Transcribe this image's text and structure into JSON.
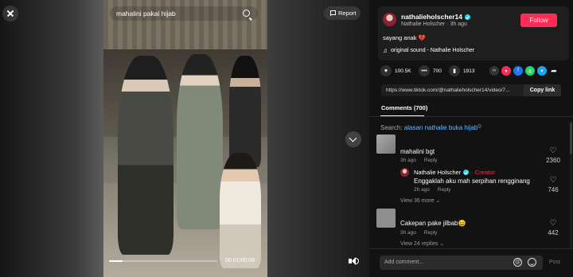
{
  "player": {
    "search_query": "mahalini pakai hijab",
    "report_label": "Report",
    "time": "00:01/00:08",
    "progress": 0.125
  },
  "post": {
    "username": "nathalieholscher14",
    "display_line": "Nathalie Holscher · 3h ago",
    "follow_label": "Follow",
    "caption": "sayang anak",
    "caption_emoji": "💔",
    "sound": "original sound - Nathalie Holscher"
  },
  "actions": {
    "likes": "100.5K",
    "comments": "700",
    "saves": "1913"
  },
  "share": {
    "link": "https://www.tiktok.com/@nathalieholscher14/video/7...",
    "copy_label": "Copy link"
  },
  "comments_tab": "Comments (700)",
  "search_hint": {
    "prefix": "Search: ",
    "term": "alasan nathalie buka hijab",
    "suffix": "Q"
  },
  "comments": [
    {
      "text": "mahalini bgt",
      "time": "3h ago",
      "reply_label": "Reply",
      "likes": "2360",
      "reply": {
        "name": "Nathalie Holscher",
        "creator_label": "· Creator",
        "text": "Enggaklah aku mah serpihan rengginang",
        "time": "2h ago",
        "reply_label": "Reply",
        "likes": "746"
      },
      "view_more": "View 36 more ⌄"
    },
    {
      "text": "Cakepan pake jilbab😄",
      "time": "3h ago",
      "reply_label": "Reply",
      "likes": "442",
      "view_more": "View 24 replies ⌄"
    }
  ],
  "composer": {
    "placeholder": "Add comment...",
    "post_label": "Post"
  },
  "colors": {
    "accent": "#fe2c55",
    "verified": "#20d5ec",
    "link": "#6ab8ff"
  }
}
